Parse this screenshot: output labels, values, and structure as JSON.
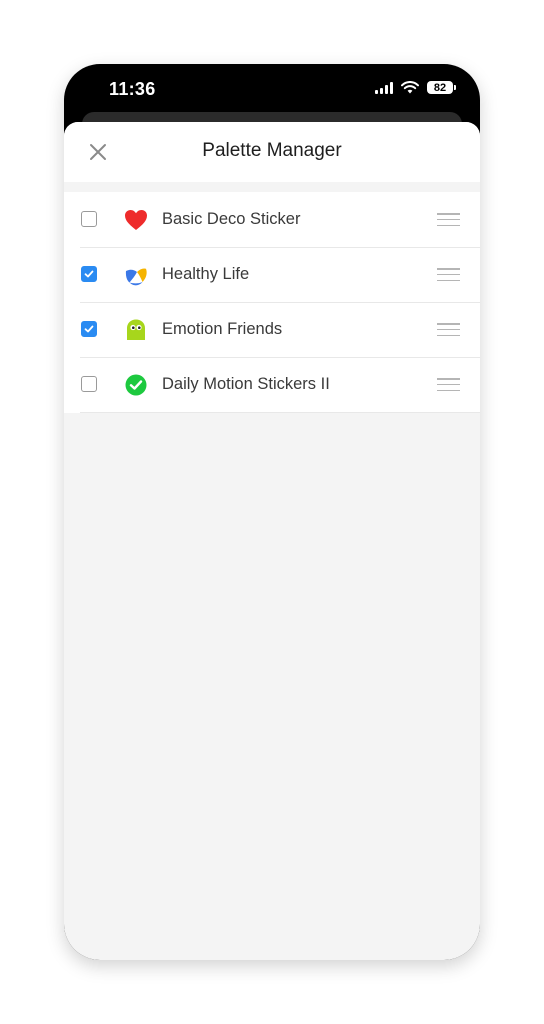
{
  "status_bar": {
    "time": "11:36",
    "battery": "82",
    "icons": [
      "cellular-signal-icon",
      "wifi-icon",
      "battery-icon"
    ]
  },
  "header": {
    "title": "Palette Manager",
    "close_icon": "close-icon"
  },
  "items": [
    {
      "label": "Basic Deco Sticker",
      "checked": false,
      "icon": "heart-icon",
      "color": "#ee2b2b"
    },
    {
      "label": "Healthy Life",
      "checked": true,
      "icon": "volleyball-icon",
      "color": "#f5b300"
    },
    {
      "label": "Emotion Friends",
      "checked": true,
      "icon": "green-character-icon",
      "color": "#a7d61c"
    },
    {
      "label": "Daily Motion Stickers II",
      "checked": false,
      "icon": "green-check-icon",
      "color": "#1dc93f"
    }
  ],
  "colors": {
    "accent": "#2a8bf2",
    "background": "#f4f4f4"
  }
}
